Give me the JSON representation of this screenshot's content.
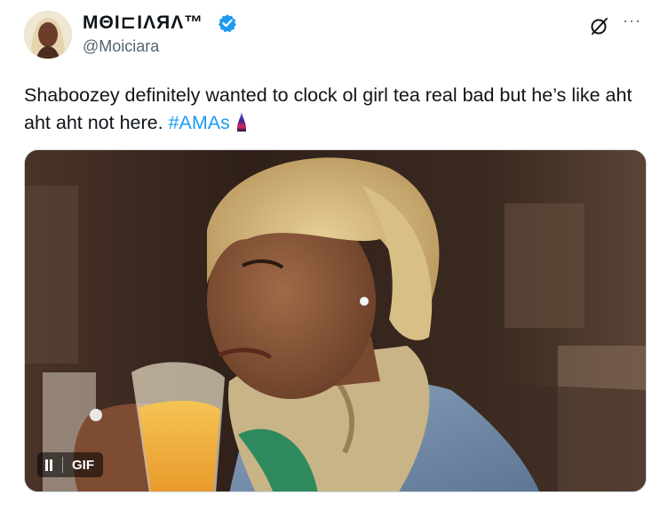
{
  "author": {
    "display_name": "MΘI⊏IΛЯΛ™",
    "handle": "@Moiciara",
    "verified": true,
    "avatar_icon": "profile-avatar"
  },
  "header_actions": {
    "grok_icon": "grok-icon",
    "more_icon": "more-options-icon",
    "more_glyph": "···"
  },
  "tweet": {
    "text": "Shaboozey definitely wanted to clock ol girl tea real bad but he’s like aht aht aht not here.",
    "hashtag": "#AMAs",
    "hashtag_emoji": "amas-flame-icon"
  },
  "media": {
    "type": "gif",
    "gif_label": "GIF",
    "pause_icon": "pause-icon"
  },
  "colors": {
    "link": "#1d9bf0",
    "verified_badge": "#1d9bf0",
    "secondary_text": "#536471",
    "primary_text": "#0f1419"
  }
}
